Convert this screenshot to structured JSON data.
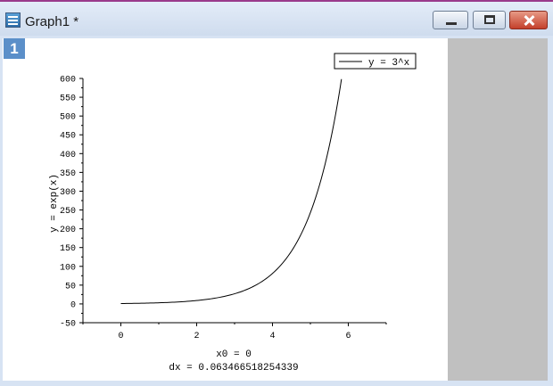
{
  "window": {
    "title": "Graph1 *",
    "layer_number": "1"
  },
  "chart_data": {
    "type": "line",
    "title": "",
    "xlabel": "x0 = 0",
    "xlabel2": "dx = 0.063466518254339",
    "ylabel": "y = exp(x)",
    "xlim": [
      -1,
      7
    ],
    "ylim": [
      -50,
      600
    ],
    "x_ticks": [
      0,
      2,
      4,
      6
    ],
    "y_ticks": [
      -50,
      0,
      50,
      100,
      150,
      200,
      250,
      300,
      350,
      400,
      450,
      500,
      550,
      600
    ],
    "grid": false,
    "legend_position": "top-right",
    "series": [
      {
        "name": "y = 3^x",
        "function": "3^x",
        "x_start": 0,
        "x_end": 5.82,
        "color": "#000000"
      }
    ]
  }
}
